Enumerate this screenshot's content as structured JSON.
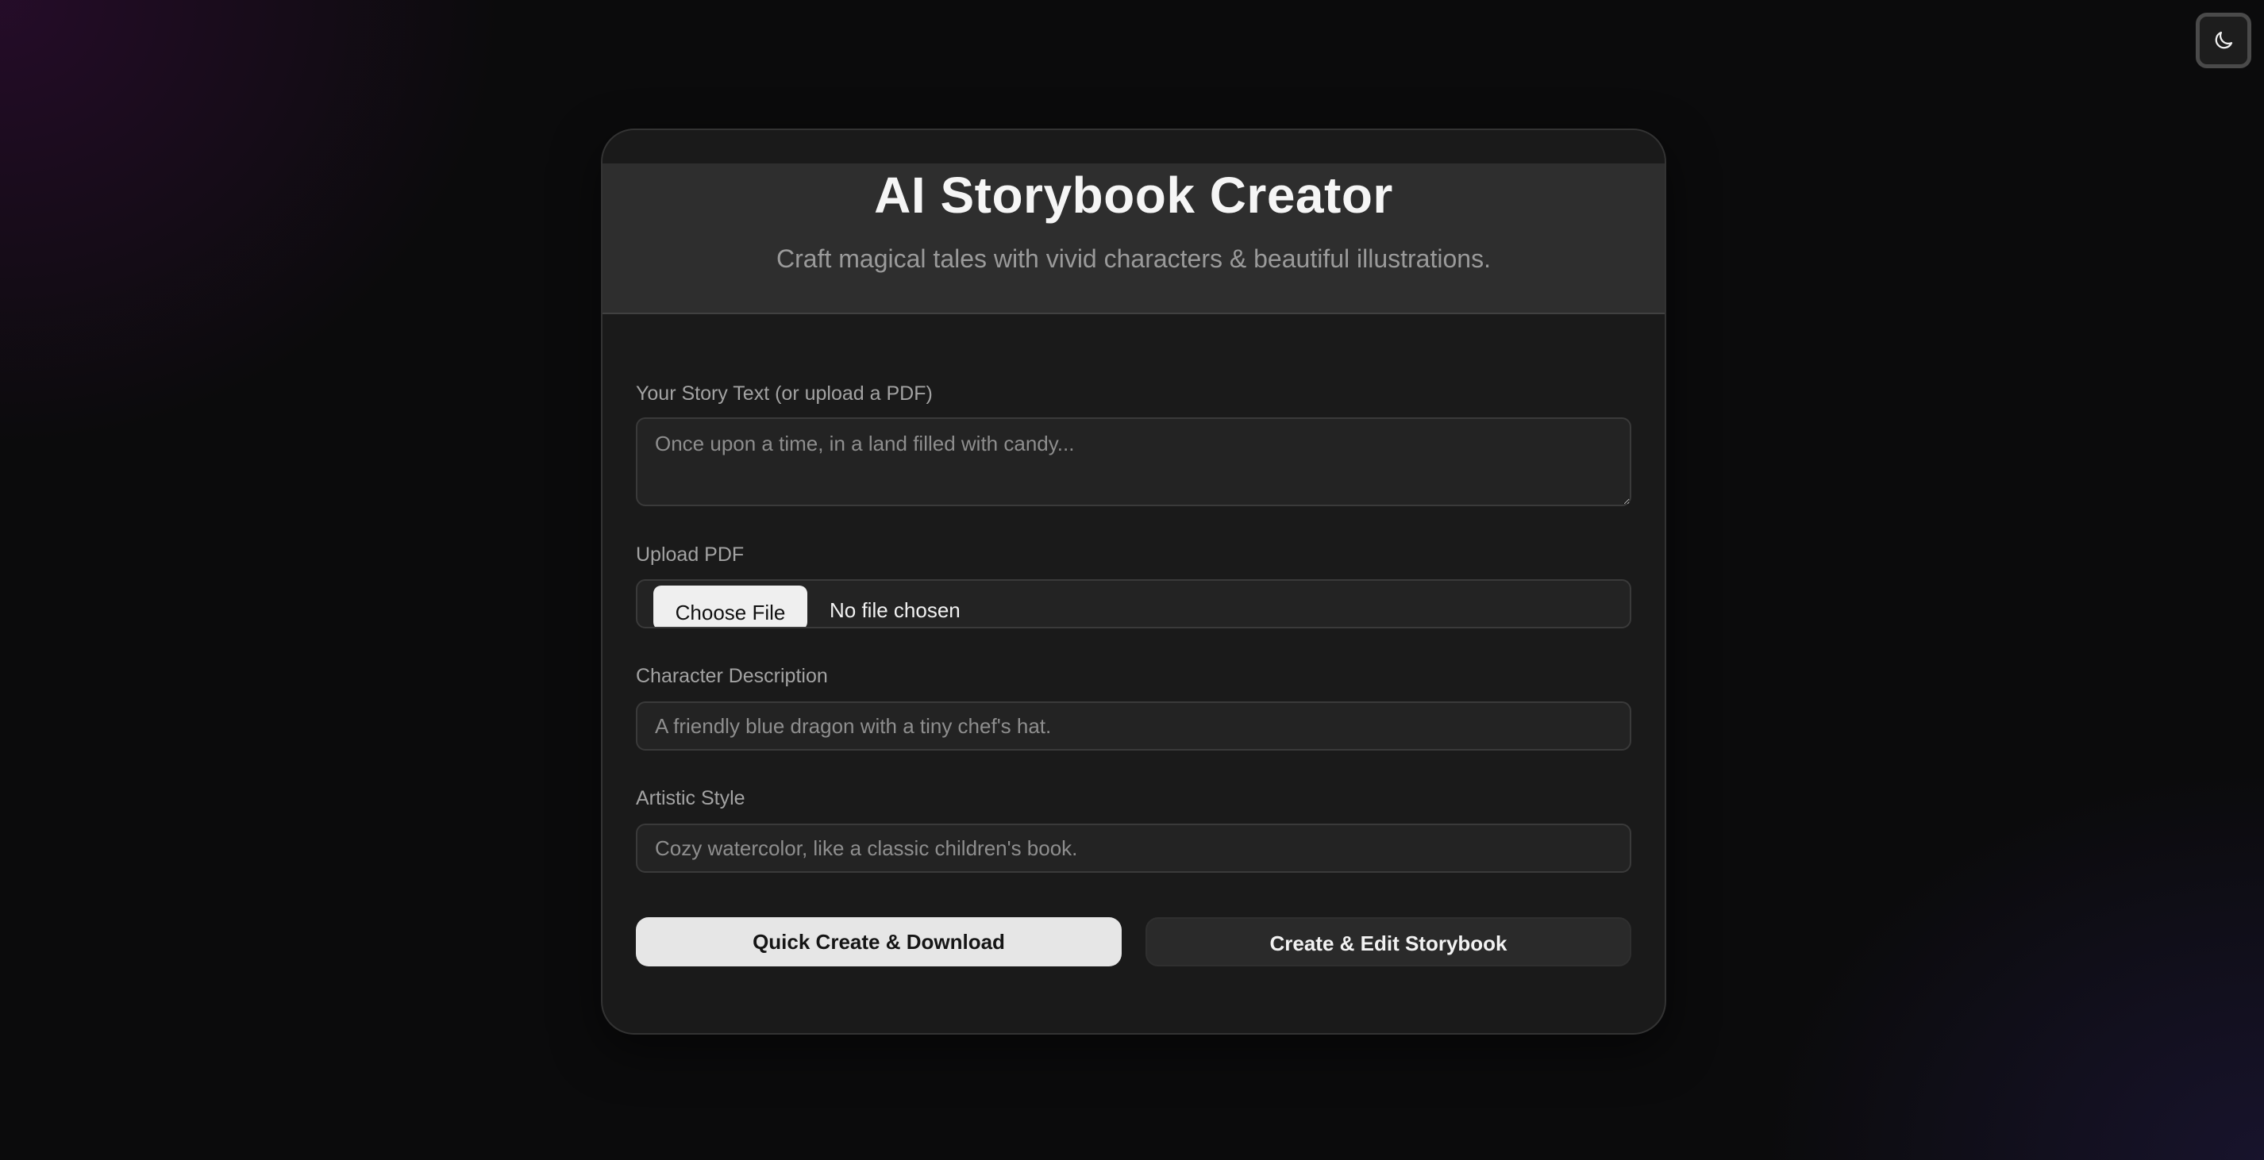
{
  "theme_toggle": {
    "icon": "moon-icon"
  },
  "header": {
    "title": "AI Storybook Creator",
    "subtitle": "Craft magical tales with vivid characters & beautiful illustrations."
  },
  "form": {
    "story": {
      "label": "Your Story Text (or upload a PDF)",
      "placeholder": "Once upon a time, in a land filled with candy...",
      "value": ""
    },
    "pdf": {
      "label": "Upload PDF",
      "button_label": "Choose File",
      "status": "No file chosen"
    },
    "character": {
      "label": "Character Description",
      "placeholder": "A friendly blue dragon with a tiny chef's hat.",
      "value": ""
    },
    "style": {
      "label": "Artistic Style",
      "placeholder": "Cozy watercolor, like a classic children's book.",
      "value": ""
    }
  },
  "actions": {
    "quick_create_label": "Quick Create & Download",
    "create_edit_label": "Create & Edit Storybook"
  },
  "colors": {
    "page_background": "#0b0b0c",
    "card_background": "#1a1a1a",
    "header_background": "#2e2e2e",
    "primary_button": "#e6e6e6",
    "secondary_button": "#2a2a2a"
  }
}
